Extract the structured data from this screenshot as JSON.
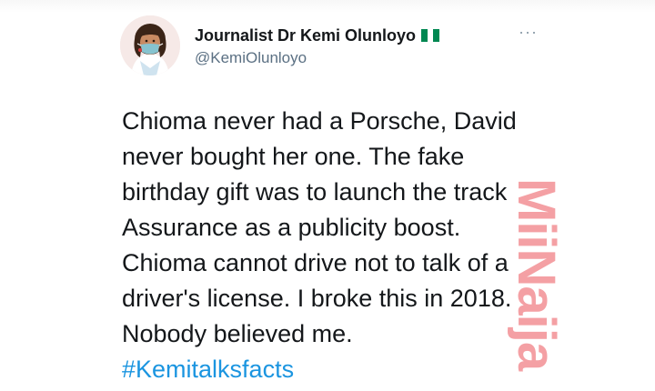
{
  "tweet": {
    "display_name": "Journalist Dr Kemi Olunloyo",
    "handle": "@KemiOlunloyo",
    "more_label": "···",
    "lines": [
      "Chioma never had a Porsche, David",
      "never bought her one. The fake",
      "birthday gift was to launch the track",
      "Assurance as a publicity boost.",
      "Chioma cannot drive not to talk of a",
      "driver's license. I broke this in 2018.",
      "Nobody believed me."
    ],
    "hashtag": "#Kemitalksfacts"
  },
  "watermark": {
    "text": "MiiNaija"
  },
  "colors": {
    "text": "#14171a",
    "handle": "#5b7083",
    "hashtag": "#1b95e0",
    "flag_green": "#008751",
    "watermark": "#f4a0a4"
  },
  "icons": {
    "avatar": "avatar-illustration",
    "flag": "nigeria-flag-icon",
    "more": "more-icon"
  }
}
